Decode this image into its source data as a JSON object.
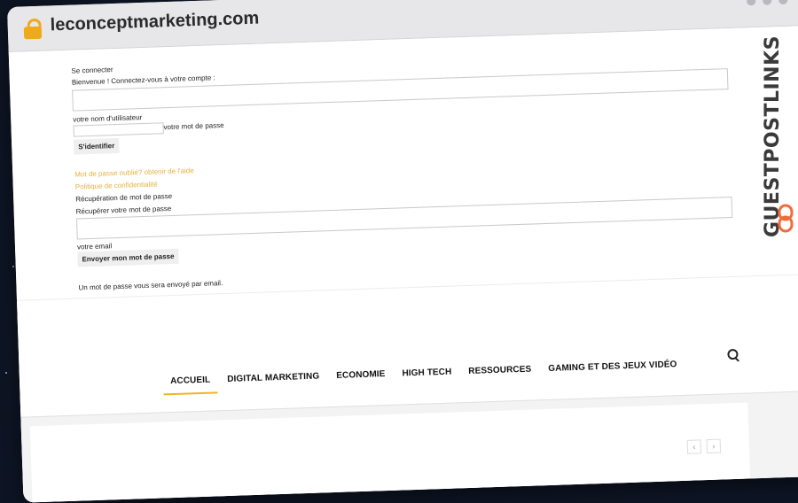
{
  "browser": {
    "url": "leconceptmarketing.com"
  },
  "brand": {
    "name": "GUESTPOSTLINKS"
  },
  "login": {
    "heading": "Se connecter",
    "welcome": "Bienvenue ! Connectez-vous à votre compte :",
    "username_label": "votre nom d'utilisateur",
    "password_label": "votre mot de passe",
    "submit_label": "S'identifier",
    "forgot_link": "Mot de passe oublié? obtenir de l'aide",
    "privacy_link": "Politique de confidentialité"
  },
  "recovery": {
    "heading": "Récupération de mot de passe",
    "subheading": "Récupérer votre mot de passe",
    "email_label": "votre email",
    "submit_label": "Envoyer mon mot de passe",
    "note": "Un mot de passe vous sera envoyé par email."
  },
  "nav": {
    "items": [
      "ACCUEIL",
      "DIGITAL MARKETING",
      "ECONOMIE",
      "HIGH TECH",
      "RESSOURCES",
      "GAMING ET DES JEUX VIDÉO"
    ],
    "active_index": 0
  },
  "colors": {
    "accent": "#f1b32a",
    "link": "#e3b23c",
    "brand_logo": "#f26b3a"
  },
  "icons": {
    "lock": "lock-icon",
    "search": "search-icon",
    "prev": "chevron-left-icon",
    "next": "chevron-right-icon"
  }
}
